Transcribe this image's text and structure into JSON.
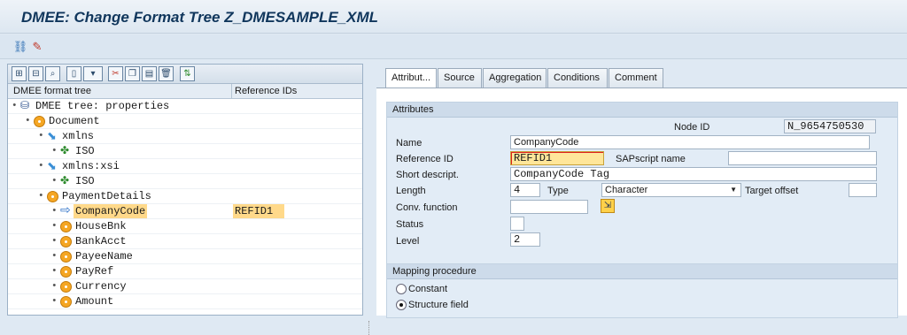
{
  "window": {
    "title": "DMEE: Change Format Tree Z_DMESAMPLE_XML"
  },
  "appbar": {
    "tools": [
      "hierarchy-icon",
      "pencil-icon"
    ]
  },
  "tree": {
    "toolbar_icons": [
      "expand-all-icon",
      "collapse-all-icon",
      "find-icon",
      "new-node-icon",
      "new-node-menu-icon",
      "cut-icon",
      "copy-icon",
      "paste-icon",
      "delete-icon",
      "attributes-icon"
    ],
    "columns": [
      "DMEE format tree",
      "Reference IDs"
    ],
    "rows": [
      {
        "label": "DMEE tree: properties",
        "icon": "tree-root-icon",
        "level": 0,
        "refid": ""
      },
      {
        "label": "Document",
        "icon": "element-icon",
        "level": 1,
        "refid": ""
      },
      {
        "label": "xmlns",
        "icon": "attribute-icon",
        "level": 2,
        "refid": ""
      },
      {
        "label": "ISO",
        "icon": "atom-icon",
        "level": 3,
        "refid": ""
      },
      {
        "label": "xmlns:xsi",
        "icon": "attribute-icon",
        "level": 2,
        "refid": ""
      },
      {
        "label": "ISO",
        "icon": "atom-icon",
        "level": 3,
        "refid": ""
      },
      {
        "label": "PaymentDetails",
        "icon": "element-icon",
        "level": 2,
        "refid": ""
      },
      {
        "label": "CompanyCode",
        "icon": "arrow-icon",
        "level": 3,
        "refid": "REFID1",
        "selected": true
      },
      {
        "label": "HouseBnk",
        "icon": "element-icon",
        "level": 3,
        "refid": ""
      },
      {
        "label": "BankAcct",
        "icon": "element-icon",
        "level": 3,
        "refid": ""
      },
      {
        "label": "PayeeName",
        "icon": "element-icon",
        "level": 3,
        "refid": ""
      },
      {
        "label": "PayRef",
        "icon": "element-icon",
        "level": 3,
        "refid": ""
      },
      {
        "label": "Currency",
        "icon": "element-icon",
        "level": 3,
        "refid": ""
      },
      {
        "label": "Amount",
        "icon": "element-icon",
        "level": 3,
        "refid": ""
      }
    ]
  },
  "tabs": [
    "Attribut...",
    "Source",
    "Aggregation",
    "Conditions",
    "Comment"
  ],
  "attributes": {
    "group_title": "Attributes",
    "node_id_label": "Node ID",
    "node_id_value": "N_9654750530",
    "name_label": "Name",
    "name_value": "CompanyCode",
    "refid_label": "Reference ID",
    "refid_value": "REFID1",
    "sapscript_label": "SAPscript name",
    "sapscript_value": "",
    "short_label": "Short descript.",
    "short_value": "CompanyCode Tag",
    "length_label": "Length",
    "length_value": "4",
    "type_label": "Type",
    "type_value": "Character",
    "target_offset_label": "Target offset",
    "target_offset_value": "",
    "conv_label": "Conv. function",
    "conv_value": "",
    "status_label": "Status",
    "status_value": "",
    "level_label": "Level",
    "level_value": "2"
  },
  "mapping": {
    "group_title": "Mapping procedure",
    "options": [
      {
        "label": "Constant",
        "checked": false
      },
      {
        "label": "Structure field",
        "checked": true
      }
    ]
  }
}
